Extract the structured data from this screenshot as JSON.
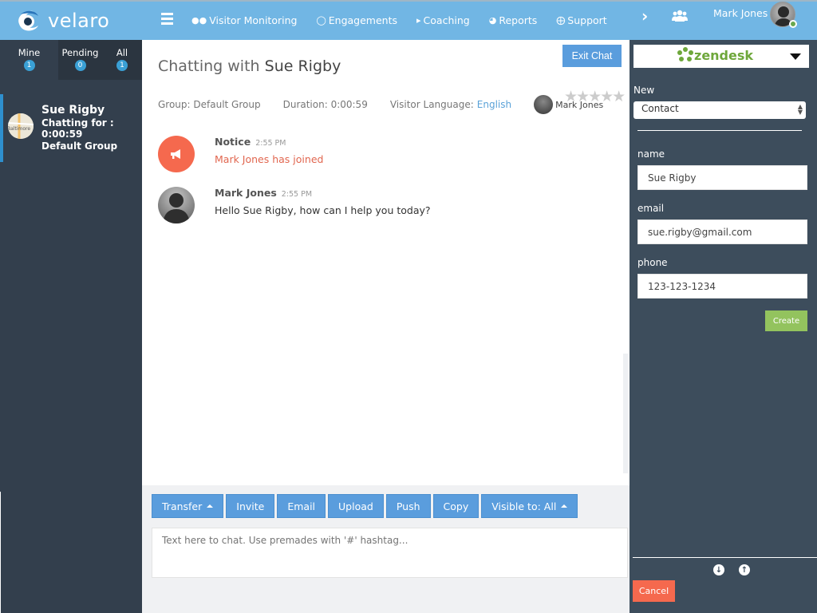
{
  "app": {
    "brand": "velaro"
  },
  "topbar": {
    "nav": [
      {
        "label": "Visitor Monitoring",
        "icon": "users-icon"
      },
      {
        "label": "Engagements",
        "icon": "comment-icon"
      },
      {
        "label": "Coaching",
        "icon": "bullhorn-icon"
      },
      {
        "label": "Reports",
        "icon": "pie-chart-icon"
      },
      {
        "label": "Support",
        "icon": "life-ring-icon"
      }
    ],
    "user_name": "Mark Jones",
    "status_color": "#6aa84f"
  },
  "leftbar": {
    "tabs": [
      {
        "label": "Mine",
        "count": "1"
      },
      {
        "label": "Pending",
        "count": "0"
      },
      {
        "label": "All",
        "count": "1"
      }
    ],
    "visitor": {
      "name": "Sue Rigby",
      "chatting_for": "Chatting for : 0:00:59",
      "group": "Default Group",
      "avatar_text": "Baltimore"
    }
  },
  "chat": {
    "title_prefix": "Chatting with",
    "title_name": "Sue Rigby",
    "exit_label": "Exit Chat",
    "group": "Group: Default Group",
    "duration": "Duration: 0:00:59",
    "language_label": "Visitor Language:",
    "language_value": "English",
    "agent_name": "Mark Jones",
    "rating_stars": "★★★★★",
    "rating_value": 0,
    "messages": [
      {
        "author": "Notice",
        "time": "2:55 PM",
        "text": "Mark Jones has joined",
        "type": "notice"
      },
      {
        "author": "Mark Jones",
        "time": "2:55 PM",
        "text": "Hello Sue Rigby, how can I help you today?",
        "type": "agent"
      }
    ]
  },
  "composer": {
    "buttons": {
      "transfer": "Transfer",
      "invite": "Invite",
      "email": "Email",
      "upload": "Upload",
      "push": "Push",
      "copy": "Copy",
      "visible": "Visible to: All"
    },
    "placeholder": "Text here to chat. Use premades with '#' hashtag..."
  },
  "rightbar": {
    "integration": "zendesk",
    "new_label": "New",
    "new_value": "Contact",
    "fields": {
      "name_label": "name",
      "name_value": "Sue Rigby",
      "email_label": "email",
      "email_value": "sue.rigby@gmail.com",
      "phone_label": "phone",
      "phone_value": "123-123-1234"
    },
    "create_label": "Create",
    "cancel_label": "Cancel"
  },
  "colors": {
    "topbar": "#71b6e4",
    "sidebar": "#333f4d",
    "rightbar": "#3d4d5c",
    "button": "#5a9ddd",
    "notice": "#f5694e",
    "create": "#93c35e"
  }
}
